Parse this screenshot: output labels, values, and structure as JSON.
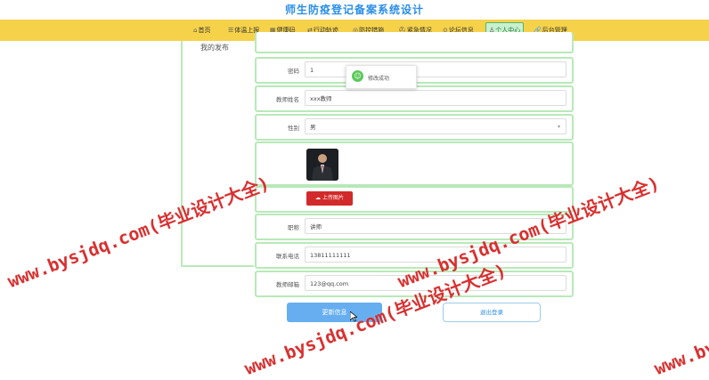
{
  "app": {
    "title": "师生防疫登记备案系统设计"
  },
  "nav": {
    "items": [
      {
        "icon": "home-icon",
        "label": "首页"
      },
      {
        "icon": "report-icon",
        "label": "体温上报"
      },
      {
        "icon": "qrcode-icon",
        "label": "健康码"
      },
      {
        "icon": "route-icon",
        "label": "行动轨迹"
      },
      {
        "icon": "shield-icon",
        "label": "防控措施"
      },
      {
        "icon": "emergency-icon",
        "label": "紧急情况"
      },
      {
        "icon": "forum-icon",
        "label": "论坛信息"
      },
      {
        "icon": "user-icon",
        "label": "个人中心",
        "active": true
      },
      {
        "icon": "admin-icon",
        "label": "后台管理"
      }
    ]
  },
  "sidebar": {
    "label": "我的发布"
  },
  "form": {
    "password": {
      "label": "密码",
      "value": "1"
    },
    "teacher_name": {
      "label": "教师姓名",
      "value": "xxx教师"
    },
    "gender": {
      "label": "性别",
      "value": "男"
    },
    "upload_label": "上传图片",
    "title_field": {
      "label": "职称",
      "value": "讲师"
    },
    "phone": {
      "label": "联系电话",
      "value": "13811111111"
    },
    "email": {
      "label": "教师邮箱",
      "value": "123@qq.com"
    },
    "save_label": "更新信息",
    "logout_label": "退出登录"
  },
  "toast": {
    "message": "修改成功"
  },
  "watermark": {
    "text": "www.bysjdq.com(毕业设计大全)",
    "color": "#d61e1e"
  },
  "colors": {
    "title": "#2a8ee8",
    "navbar": "#f6d24a",
    "panel_border": "#b8e9b8",
    "upload_button": "#d22a2a",
    "save_button": "#66aef0"
  }
}
